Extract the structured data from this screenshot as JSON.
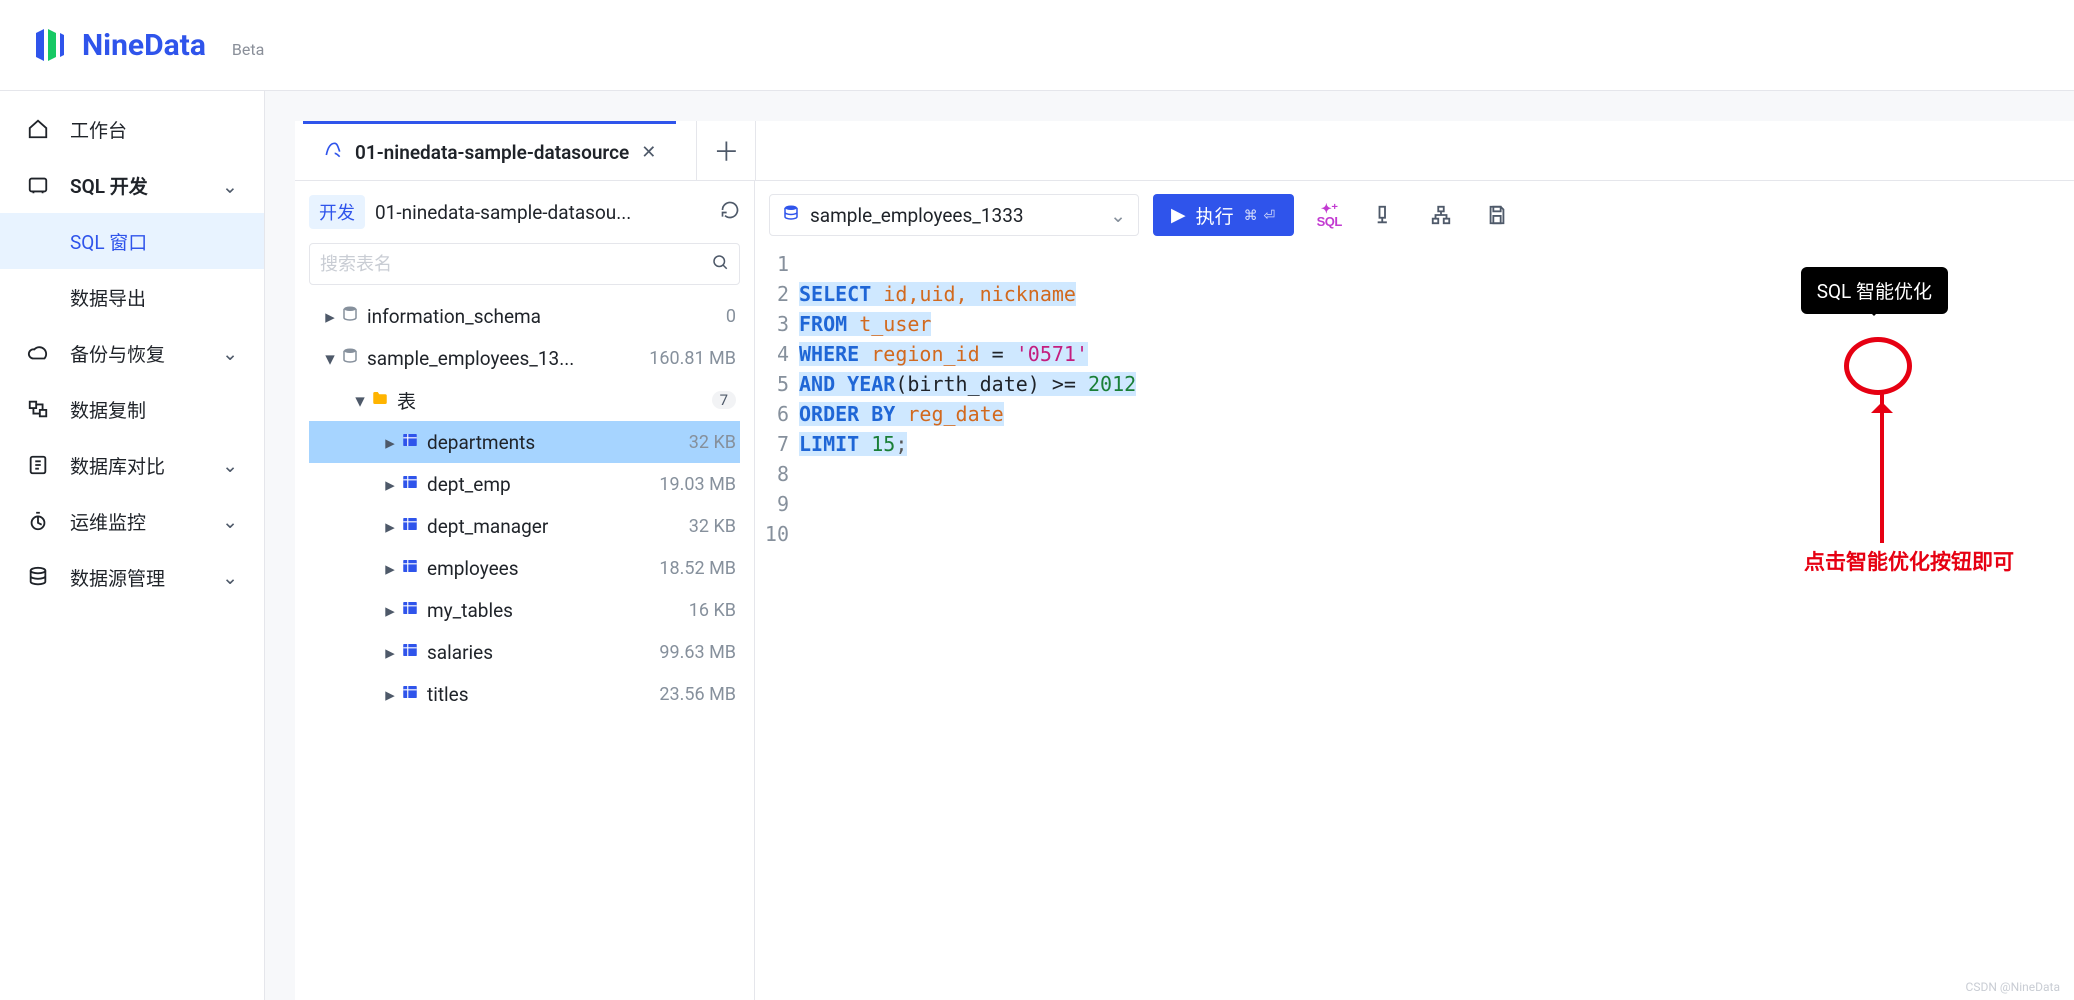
{
  "brand": {
    "name": "NineData",
    "tag": "Beta"
  },
  "sidebar": {
    "workbench": "工作台",
    "sqlDev": "SQL 开发",
    "sub": {
      "sqlWindow": "SQL 窗口",
      "export": "数据导出"
    },
    "backup": "备份与恢复",
    "replication": "数据复制",
    "compare": "数据库对比",
    "ops": "运维监控",
    "datasource": "数据源管理"
  },
  "tab": {
    "label": "01-ninedata-sample-datasource"
  },
  "explorer": {
    "env": "开发",
    "datasource": "01-ninedata-sample-datasou...",
    "searchPlaceholder": "搜索表名",
    "dbs": [
      {
        "name": "information_schema",
        "size": "0"
      },
      {
        "name": "sample_employees_13...",
        "size": "160.81 MB",
        "expanded": true,
        "tablesLabel": "表",
        "tablesCount": "7",
        "tables": [
          {
            "name": "departments",
            "size": "32 KB",
            "selected": true
          },
          {
            "name": "dept_emp",
            "size": "19.03 MB"
          },
          {
            "name": "dept_manager",
            "size": "32 KB"
          },
          {
            "name": "employees",
            "size": "18.52 MB"
          },
          {
            "name": "my_tables",
            "size": "16 KB"
          },
          {
            "name": "salaries",
            "size": "99.63 MB"
          },
          {
            "name": "titles",
            "size": "23.56 MB"
          }
        ]
      }
    ]
  },
  "toolbar": {
    "selectedDb": "sample_employees_1333",
    "execLabel": "执行",
    "execShortcut": "⌘ ⏎",
    "tooltip": "SQL 智能优化",
    "aiLabel": "SQL"
  },
  "code": {
    "lines": [
      {
        "n": 1,
        "tokens": []
      },
      {
        "n": 2,
        "tokens": [
          {
            "t": "SELECT",
            "c": "kw"
          },
          {
            "t": " "
          },
          {
            "t": "id,uid, nickname",
            "c": "id"
          }
        ]
      },
      {
        "n": 3,
        "tokens": [
          {
            "t": "FROM",
            "c": "kw"
          },
          {
            "t": " "
          },
          {
            "t": "t_user",
            "c": "id"
          }
        ]
      },
      {
        "n": 4,
        "tokens": [
          {
            "t": "WHERE",
            "c": "kw"
          },
          {
            "t": " "
          },
          {
            "t": "region_id",
            "c": "id"
          },
          {
            "t": " = "
          },
          {
            "t": "'0571'",
            "c": "str"
          }
        ]
      },
      {
        "n": 5,
        "tokens": [
          {
            "t": "AND",
            "c": "kw"
          },
          {
            "t": " "
          },
          {
            "t": "YEAR",
            "c": "kw"
          },
          {
            "t": "(birth_date) >= ",
            "c": ""
          },
          {
            "t": "2012",
            "c": "num"
          }
        ]
      },
      {
        "n": 6,
        "tokens": [
          {
            "t": "ORDER BY",
            "c": "kw"
          },
          {
            "t": " "
          },
          {
            "t": "reg_date",
            "c": "id"
          }
        ]
      },
      {
        "n": 7,
        "tokens": [
          {
            "t": "LIMIT",
            "c": "kw"
          },
          {
            "t": " "
          },
          {
            "t": "15",
            "c": "num"
          },
          {
            "t": ";",
            "c": "semi"
          }
        ]
      },
      {
        "n": 8,
        "tokens": []
      },
      {
        "n": 9,
        "tokens": []
      },
      {
        "n": 10,
        "tokens": []
      }
    ]
  },
  "annotation": {
    "text": "点击智能优化按钮即可"
  },
  "watermark": "CSDN @NineData"
}
